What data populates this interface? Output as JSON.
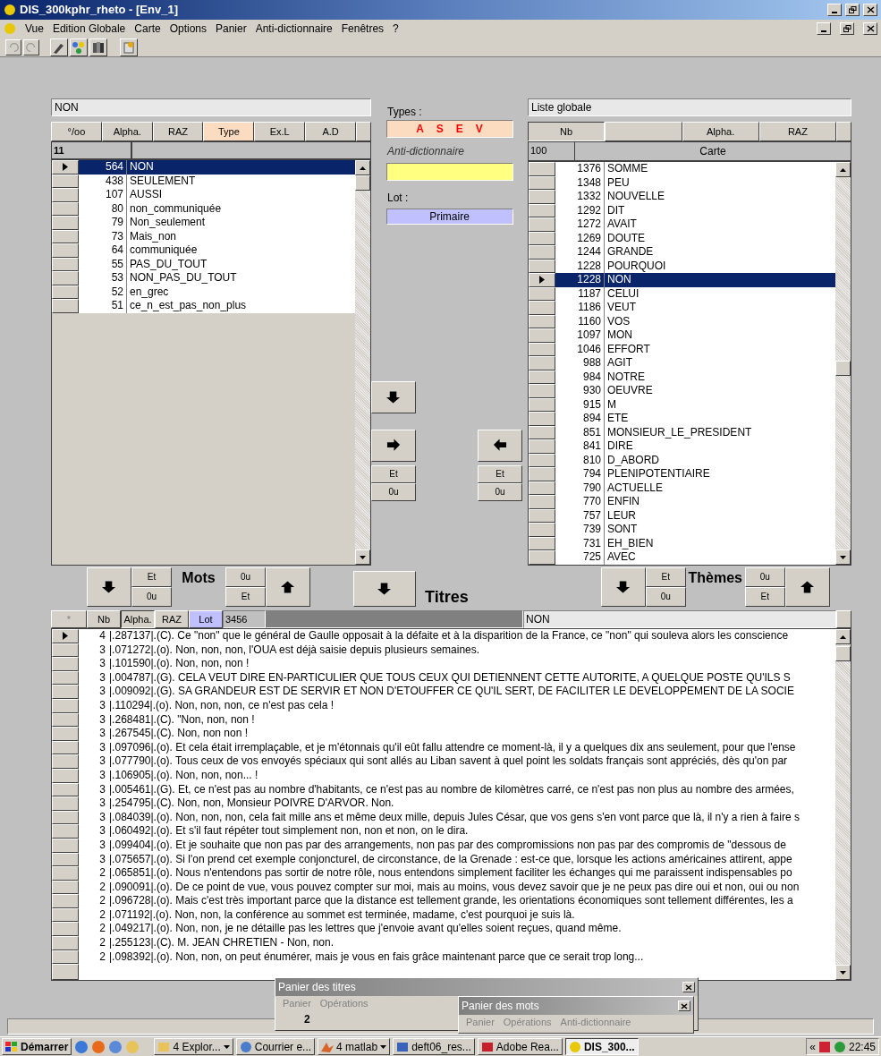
{
  "window": {
    "title": "DIS_300kphr_rheto - [Env_1]"
  },
  "menu": [
    "Vue",
    "Edition Globale",
    "Carte",
    "Options",
    "Panier",
    "Anti-dictionnaire",
    "Fenêtres",
    "?"
  ],
  "left_panel": {
    "title": "NON",
    "buttons": [
      {
        "label": "°/oo",
        "selected": false
      },
      {
        "label": "Alpha.",
        "selected": false
      },
      {
        "label": "RAZ",
        "selected": false
      },
      {
        "label": "Type",
        "selected": true
      },
      {
        "label": "Ex.L",
        "selected": false
      },
      {
        "label": "A.D",
        "selected": false
      }
    ],
    "count": "11",
    "rows": [
      {
        "count": "564",
        "word": "NON",
        "selected": true
      },
      {
        "count": "438",
        "word": "SEULEMENT",
        "selected": false
      },
      {
        "count": "107",
        "word": "AUSSI",
        "selected": false
      },
      {
        "count": "80",
        "word": "non_communiquée",
        "selected": false
      },
      {
        "count": "79",
        "word": "Non_seulement",
        "selected": false
      },
      {
        "count": "73",
        "word": "Mais_non",
        "selected": false
      },
      {
        "count": "64",
        "word": "communiquée",
        "selected": false
      },
      {
        "count": "55",
        "word": "PAS_DU_TOUT",
        "selected": false
      },
      {
        "count": "53",
        "word": "NON_PAS_DU_TOUT",
        "selected": false
      },
      {
        "count": "52",
        "word": "en_grec",
        "selected": false
      },
      {
        "count": "51",
        "word": "ce_n_est_pas_non_plus",
        "selected": false
      }
    ]
  },
  "middle": {
    "types_label": "Types :",
    "types": [
      "A",
      "S",
      "E",
      "V"
    ],
    "antidictionary_label": "Anti-dictionnaire",
    "lot_label": "Lot :",
    "lot_value": "Primaire",
    "left_buttons": [
      "Et",
      "0u"
    ],
    "right_buttons": [
      "Et",
      "0u"
    ]
  },
  "right_panel": {
    "title": "Liste globale",
    "buttons": [
      {
        "label": "Nb",
        "selected": true
      },
      {
        "selected": false
      },
      {
        "label": "Alpha.",
        "selected": false
      },
      {
        "label": "RAZ",
        "selected": false
      }
    ],
    "count": "100",
    "column": "Carte",
    "rows": [
      {
        "count": "1376",
        "word": "SOMME",
        "selected": false
      },
      {
        "count": "1348",
        "word": "PEU",
        "selected": false
      },
      {
        "count": "1332",
        "word": "NOUVELLE",
        "selected": false
      },
      {
        "count": "1292",
        "word": "DIT",
        "selected": false
      },
      {
        "count": "1272",
        "word": "AVAIT",
        "selected": false
      },
      {
        "count": "1269",
        "word": "DOUTE",
        "selected": false
      },
      {
        "count": "1244",
        "word": "GRANDE",
        "selected": false
      },
      {
        "count": "1228",
        "word": "POURQUOI",
        "selected": false
      },
      {
        "count": "1228",
        "word": "NON",
        "selected": true
      },
      {
        "count": "1187",
        "word": "CELUI",
        "selected": false
      },
      {
        "count": "1186",
        "word": "VEUT",
        "selected": false
      },
      {
        "count": "1160",
        "word": "VOS",
        "selected": false
      },
      {
        "count": "1097",
        "word": "MON",
        "selected": false
      },
      {
        "count": "1046",
        "word": "EFFORT",
        "selected": false
      },
      {
        "count": "988",
        "word": "AGIT",
        "selected": false
      },
      {
        "count": "984",
        "word": "NOTRE",
        "selected": false
      },
      {
        "count": "930",
        "word": "OEUVRE",
        "selected": false
      },
      {
        "count": "915",
        "word": "M",
        "selected": false
      },
      {
        "count": "894",
        "word": "ETE",
        "selected": false
      },
      {
        "count": "851",
        "word": "MONSIEUR_LE_PRESIDENT",
        "selected": false
      },
      {
        "count": "841",
        "word": "DIRE",
        "selected": false
      },
      {
        "count": "810",
        "word": "D_ABORD",
        "selected": false
      },
      {
        "count": "794",
        "word": "PLENIPOTENTIAIRE",
        "selected": false
      },
      {
        "count": "790",
        "word": "ACTUELLE",
        "selected": false
      },
      {
        "count": "770",
        "word": "ENFIN",
        "selected": false
      },
      {
        "count": "757",
        "word": "LEUR",
        "selected": false
      },
      {
        "count": "739",
        "word": "SONT",
        "selected": false
      },
      {
        "count": "731",
        "word": "EH_BIEN",
        "selected": false
      },
      {
        "count": "725",
        "word": "AVEC",
        "selected": false
      }
    ]
  },
  "mots_bar": {
    "label": "Mots",
    "left_buttons": [
      "Et",
      "0u"
    ],
    "right_buttons": [
      "0u",
      "Et"
    ]
  },
  "titres_bar": {
    "label": "Titres"
  },
  "themes_bar": {
    "label": "Thèmes",
    "left_buttons": [
      "Et",
      "0u"
    ],
    "right_buttons": [
      "0u",
      "Et"
    ]
  },
  "results": {
    "buttons": [
      {
        "label": "*",
        "kind": "plain",
        "selected": false
      },
      {
        "label": "Nb",
        "kind": "plain",
        "selected": false
      },
      {
        "label": "Alpha.",
        "kind": "plain",
        "selected": true
      },
      {
        "label": "RAZ",
        "kind": "plain",
        "selected": false
      },
      {
        "label": "Lot",
        "kind": "lot",
        "selected": false
      }
    ],
    "lot_value": "3456",
    "query": "NON",
    "rows": [
      {
        "count": "4",
        "text": "|.287137|.(C). Ce \"non\" que le général de Gaulle opposait à la défaite et à la disparition de la France, ce \"non\" qui souleva alors les conscience",
        "selected": true
      },
      {
        "count": "3",
        "text": "|.071272|.(o). Non, non, non, l'OUA est déjà saisie depuis plusieurs semaines.",
        "selected": false
      },
      {
        "count": "3",
        "text": "|.101590|.(o). Non, non, non !",
        "selected": false
      },
      {
        "count": "3",
        "text": "|.004787|.(G). CELA VEUT DIRE EN-PARTICULIER QUE TOUS CEUX QUI DETIENNENT CETTE AUTORITE, A QUELQUE POSTE QU'ILS S",
        "selected": false
      },
      {
        "count": "3",
        "text": "|.009092|.(G). SA GRANDEUR EST DE SERVIR ET NON D'ETOUFFER CE QU'IL SERT, DE FACILITER LE DEVELOPPEMENT DE LA SOCIE",
        "selected": false
      },
      {
        "count": "3",
        "text": "|.110294|.(o). Non, non, non, ce n'est pas cela !",
        "selected": false
      },
      {
        "count": "3",
        "text": "|.268481|.(C). \"Non, non, non !",
        "selected": false
      },
      {
        "count": "3",
        "text": "|.267545|.(C). Non, non non !",
        "selected": false
      },
      {
        "count": "3",
        "text": "|.097096|.(o). Et cela était irremplaçable, et je m'étonnais qu'il eût fallu attendre ce moment-là, il y a quelques dix ans seulement, pour que l'ense",
        "selected": false
      },
      {
        "count": "3",
        "text": "|.077790|.(o). Tous ceux de vos envoyés spéciaux qui sont allés au Liban savent à quel point les soldats français sont appréciés, dès qu'on par",
        "selected": false
      },
      {
        "count": "3",
        "text": "|.106905|.(o). Non, non, non... !",
        "selected": false
      },
      {
        "count": "3",
        "text": "|.005461|.(G). Et, ce n'est pas au nombre d'habitants, ce n'est pas au nombre de kilomètres carré, ce n'est pas non plus au nombre des armées,",
        "selected": false
      },
      {
        "count": "3",
        "text": "|.254795|.(C). Non, non, Monsieur POIVRE D'ARVOR. Non.",
        "selected": false
      },
      {
        "count": "3",
        "text": "|.084039|.(o). Non, non, non, cela fait mille ans et même deux mille, depuis Jules César, que vos gens s'en vont parce que là, il n'y a rien à faire s",
        "selected": false
      },
      {
        "count": "3",
        "text": "|.060492|.(o). Et s'il faut répéter tout simplement non, non et non, on le dira.",
        "selected": false
      },
      {
        "count": "3",
        "text": "|.099404|.(o). Et je souhaite que non pas par des arrangements, non pas par des compromissions non pas par des compromis de \"dessous de",
        "selected": false
      },
      {
        "count": "3",
        "text": "|.075657|.(o). Si l'on prend cet exemple conjoncturel, de circonstance, de la Grenade : est-ce que, lorsque les actions américaines attirent, appe",
        "selected": false
      },
      {
        "count": "2",
        "text": "|.065851|.(o). Nous n'entendons pas sortir de notre rôle, nous entendons simplement faciliter les échanges qui me paraissent indispensables po",
        "selected": false
      },
      {
        "count": "2",
        "text": "|.090091|.(o). De ce point de vue, vous pouvez compter sur moi, mais au moins, vous devez savoir que je ne peux pas dire oui et non, oui ou non",
        "selected": false
      },
      {
        "count": "2",
        "text": "|.096728|.(o). Mais c'est très important parce que la distance est tellement grande, les orientations économiques sont tellement différentes, les a",
        "selected": false
      },
      {
        "count": "2",
        "text": "|.071192|.(o). Non, non, la conférence au sommet est terminée, madame, c'est pourquoi je suis là.",
        "selected": false
      },
      {
        "count": "2",
        "text": "|.049217|.(o). Non, non, je ne détaille pas les lettres que j'envoie avant qu'elles soient reçues, quand même.",
        "selected": false
      },
      {
        "count": "2",
        "text": "|.255123|.(C). M. JEAN CHRETIEN - Non, non.",
        "selected": false
      },
      {
        "count": "2",
        "text": "|.098392|.(o). Non, non, on peut énumérer, mais je vous en fais grâce maintenant parce que ce serait trop long...",
        "selected": false
      }
    ]
  },
  "basket_titles": {
    "title": "Panier des titres",
    "menu": [
      "Panier",
      "Opérations"
    ],
    "count": "2"
  },
  "basket_words": {
    "title": "Panier des mots",
    "menu": [
      "Panier",
      "Opérations",
      "Anti-dictionnaire"
    ]
  },
  "taskbar": {
    "start": "Démarrer",
    "tasks": [
      {
        "label": "4 Explor...",
        "kind": "folder",
        "selected": false,
        "dropdown": true
      },
      {
        "label": "Courrier e...",
        "kind": "mail",
        "selected": false,
        "dropdown": false
      },
      {
        "label": "4 matlab",
        "kind": "matlab",
        "selected": false,
        "dropdown": true
      },
      {
        "label": "deft06_res...",
        "kind": "document",
        "selected": false,
        "dropdown": false
      },
      {
        "label": "Adobe Rea...",
        "kind": "pdf",
        "selected": false,
        "dropdown": false
      },
      {
        "label": "DIS_300...",
        "kind": "app",
        "selected": true,
        "dropdown": false
      }
    ],
    "tray_toggle": "«",
    "clock": "22:45"
  }
}
